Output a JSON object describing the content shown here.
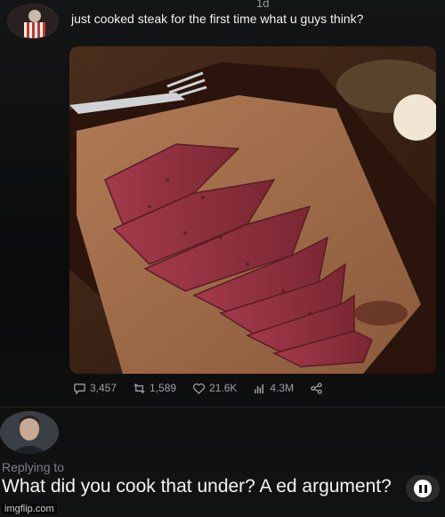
{
  "post": {
    "time": "1d",
    "text": "just cooked steak for the first time what u guys think?",
    "stats": {
      "replies": "3,457",
      "reposts": "1,589",
      "likes": "21.6K",
      "views": "4.3M"
    }
  },
  "reply": {
    "replying_to": "Replying to",
    "text": "What did you cook that under? A ed argument?"
  },
  "watermark": "imgflip.com",
  "icons": {
    "reply": "reply-icon",
    "repost": "repost-icon",
    "like": "heart-icon",
    "views": "views-icon",
    "share": "share-icon",
    "pause": "pause-icon"
  },
  "colors": {
    "background": "#0c0c0d",
    "text": "#e9e9e9",
    "muted": "#9aa0a6"
  }
}
